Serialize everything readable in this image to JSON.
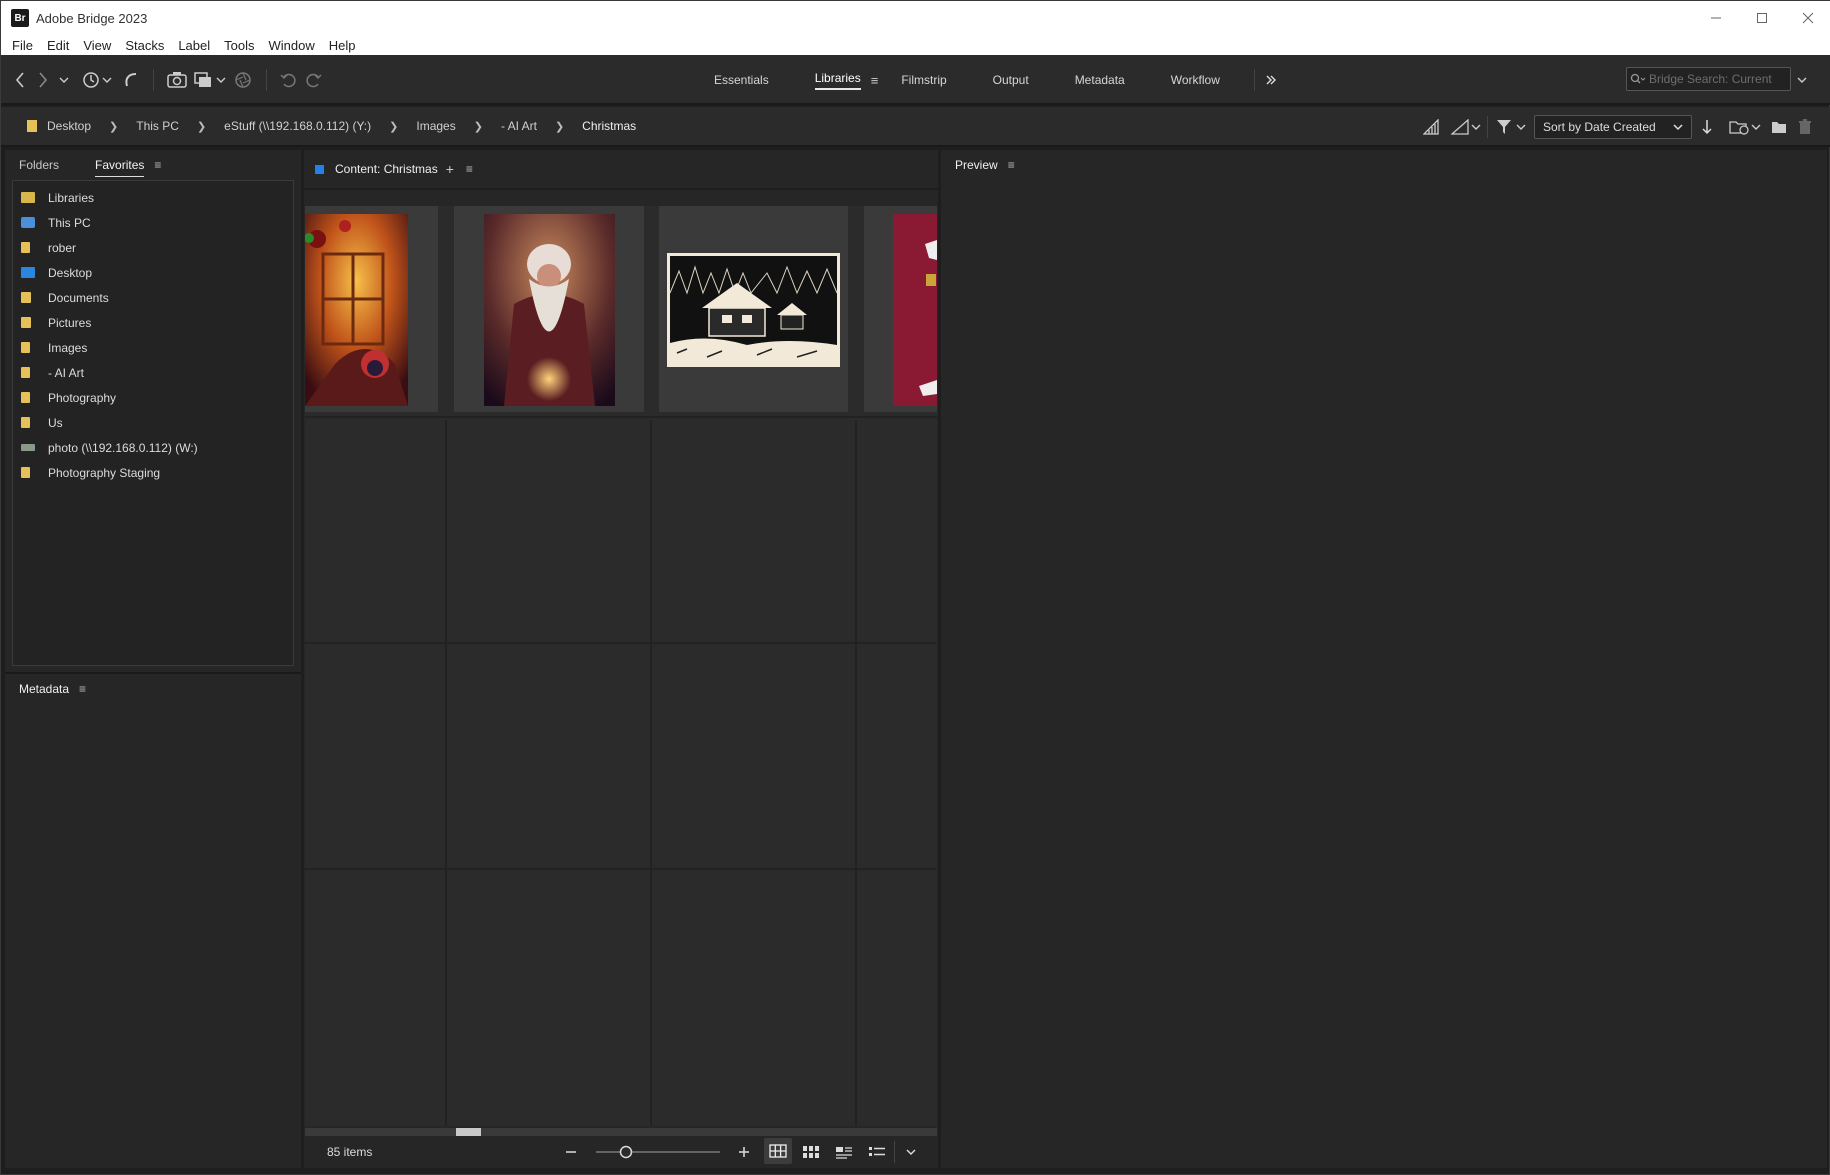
{
  "window": {
    "app_badge": "Br",
    "title": "Adobe Bridge 2023"
  },
  "menu": [
    "File",
    "Edit",
    "View",
    "Stacks",
    "Label",
    "Tools",
    "Window",
    "Help"
  ],
  "workspaces": {
    "tabs": [
      "Essentials",
      "Libraries",
      "Filmstrip",
      "Output",
      "Metadata",
      "Workflow"
    ],
    "active": "Libraries"
  },
  "search": {
    "placeholder": "Bridge Search: Current"
  },
  "path": [
    "Desktop",
    "This PC",
    "eStuff (\\\\192.168.0.112) (Y:)",
    "Images",
    "- AI Art",
    "Christmas"
  ],
  "sort": {
    "selected": "Sort by Date Created"
  },
  "left_panel": {
    "tabs": [
      "Folders",
      "Favorites"
    ],
    "active_tab": "Favorites",
    "favorites": [
      {
        "label": "Libraries",
        "icon": "libraries-icon"
      },
      {
        "label": "This PC",
        "icon": "computer-icon"
      },
      {
        "label": "rober",
        "icon": "folder-icon"
      },
      {
        "label": "Desktop",
        "icon": "desktop-folder-icon"
      },
      {
        "label": "Documents",
        "icon": "documents-folder-icon"
      },
      {
        "label": "Pictures",
        "icon": "pictures-folder-icon"
      },
      {
        "label": "Images",
        "icon": "folder-icon"
      },
      {
        "label": "- AI Art",
        "icon": "folder-icon"
      },
      {
        "label": "Photography",
        "icon": "folder-icon"
      },
      {
        "label": "Us",
        "icon": "folder-icon"
      },
      {
        "label": "photo (\\\\192.168.0.112) (W:)",
        "icon": "network-drive-icon"
      },
      {
        "label": "Photography Staging",
        "icon": "folder-icon"
      }
    ]
  },
  "metadata_panel": {
    "title": "Metadata"
  },
  "content": {
    "title": "Content: Christmas",
    "item_count": "85 items",
    "view_mode": "thumbnail-grid",
    "thumbnails": [
      {
        "name": "child-by-christmas-window-thumbnail"
      },
      {
        "name": "santa-claus-portrait-thumbnail"
      },
      {
        "name": "snowy-cabin-woodcut-thumbnail"
      },
      {
        "name": "red-card-thumbnail"
      }
    ]
  },
  "preview_panel": {
    "title": "Preview"
  },
  "colors": {
    "accent": "#2680eb",
    "folder": "#e6c157",
    "panel_bg": "#262626"
  }
}
